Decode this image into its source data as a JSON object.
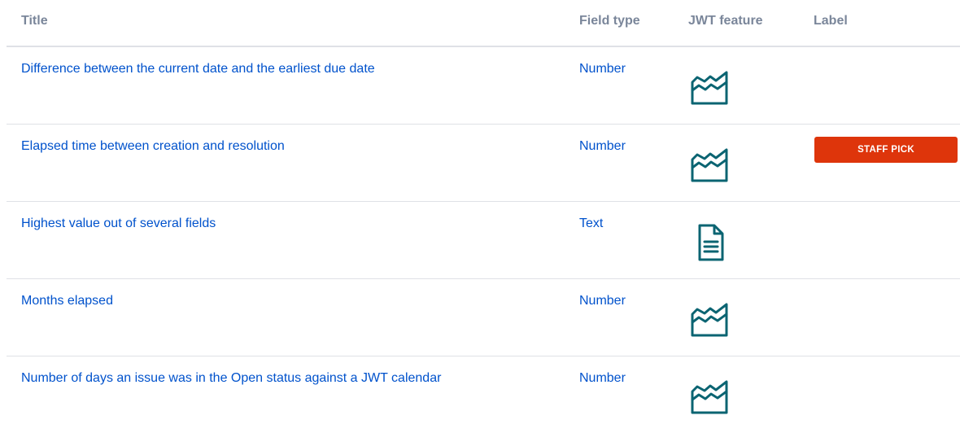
{
  "headers": {
    "title": "Title",
    "field_type": "Field type",
    "jwt_feature": "JWT feature",
    "label": "Label"
  },
  "rows": [
    {
      "title": "Difference between the current date and the earliest due date",
      "field_type": "Number",
      "feature_icon": "calculated-field-icon",
      "label": ""
    },
    {
      "title": "Elapsed time between creation and resolution",
      "field_type": "Number",
      "feature_icon": "calculated-field-icon",
      "label": "STAFF PICK"
    },
    {
      "title": "Highest value out of several fields",
      "field_type": "Text",
      "feature_icon": "document-icon",
      "label": ""
    },
    {
      "title": "Months elapsed",
      "field_type": "Number",
      "feature_icon": "calculated-field-icon",
      "label": ""
    },
    {
      "title": "Number of days an issue was in the Open status against a JWT calendar",
      "field_type": "Number",
      "feature_icon": "calculated-field-icon",
      "label": ""
    }
  ],
  "colors": {
    "link": "#0052cc",
    "header_text": "#7a869a",
    "icon": "#0b6472",
    "badge_bg": "#de350b",
    "divider": "#dfe1e6"
  }
}
